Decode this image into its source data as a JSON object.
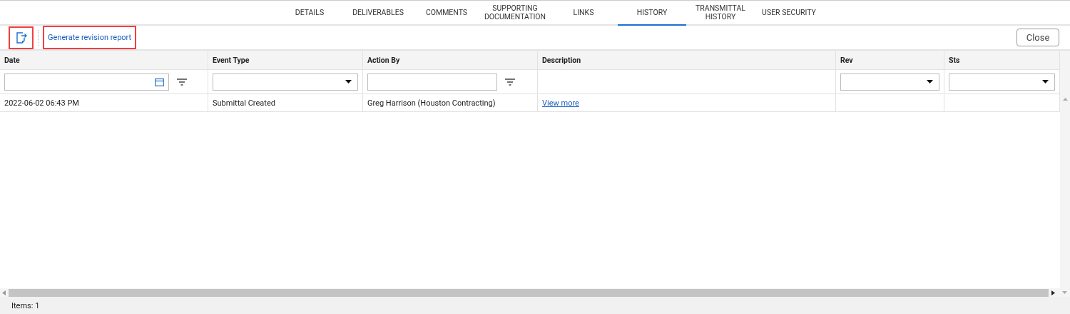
{
  "tabs": [
    {
      "label": "DETAILS",
      "selected": false
    },
    {
      "label": "DELIVERABLES",
      "selected": false
    },
    {
      "label": "COMMENTS",
      "selected": false
    },
    {
      "label": "SUPPORTING DOCUMENTATION",
      "selected": false
    },
    {
      "label": "LINKS",
      "selected": false
    },
    {
      "label": "HISTORY",
      "selected": true
    },
    {
      "label": "TRANSMITTAL HISTORY",
      "selected": false
    },
    {
      "label": "USER SECURITY",
      "selected": false
    }
  ],
  "toolbar": {
    "export_icon_highlighted": true,
    "report_link": {
      "label": "Generate revision report",
      "highlighted": true
    },
    "close_button": "Close"
  },
  "table": {
    "columns": [
      {
        "label": "Date",
        "kind": "date"
      },
      {
        "label": "Event Type",
        "kind": "select"
      },
      {
        "label": "Action By",
        "kind": "text"
      },
      {
        "label": "Description",
        "kind": "none"
      },
      {
        "label": "Rev",
        "kind": "select"
      },
      {
        "label": "Sts",
        "kind": "select"
      }
    ],
    "rows": [
      {
        "cells": [
          {
            "text": "2022-06-02 06:43 PM",
            "kind": "text"
          },
          {
            "text": "Submittal Created",
            "kind": "text"
          },
          {
            "text": "Greg Harrison (Houston Contracting)",
            "kind": "text"
          },
          {
            "text": "View more",
            "kind": "link"
          }
        ]
      }
    ]
  },
  "status_bar": "Items: 1"
}
